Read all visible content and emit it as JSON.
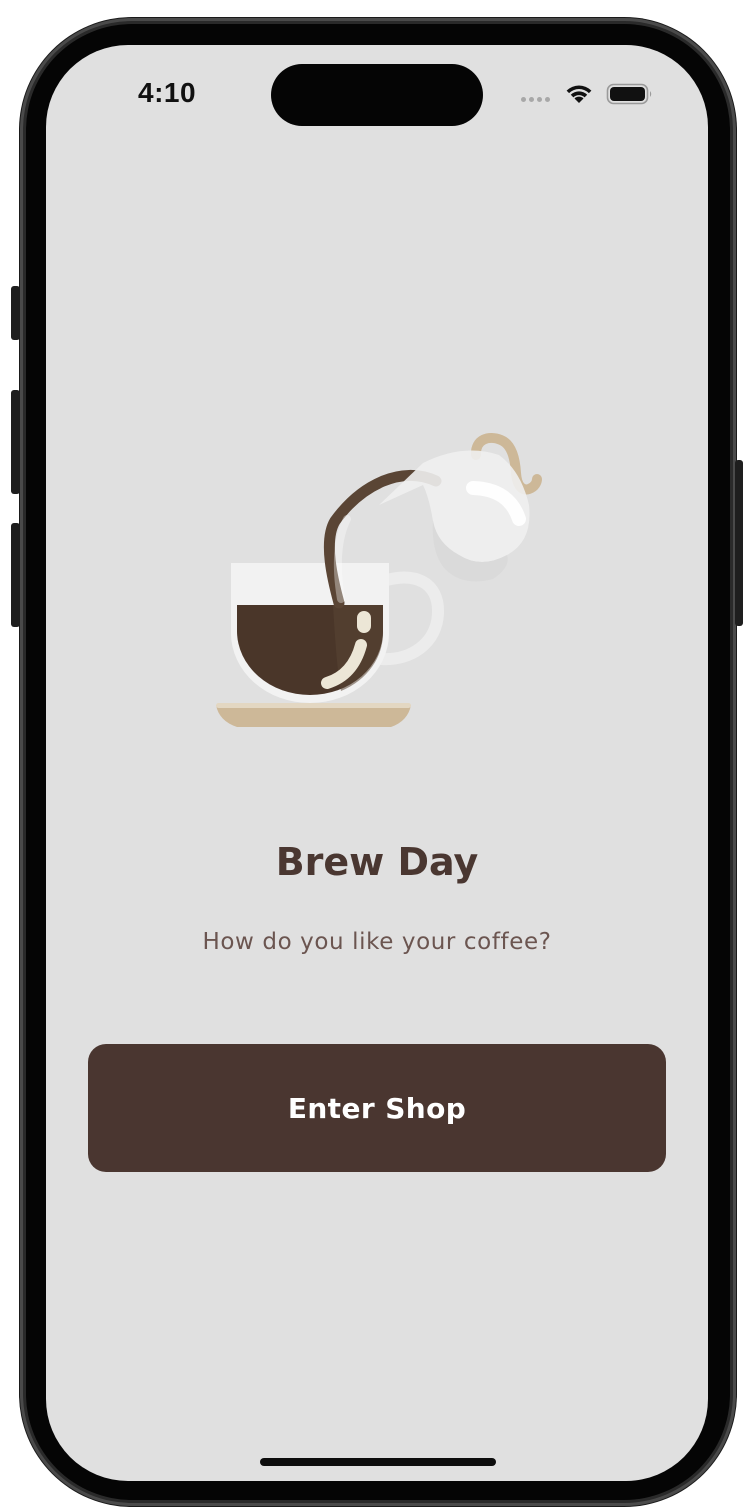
{
  "status_bar": {
    "time": "4:10",
    "wifi_icon": "wifi-icon",
    "battery_icon": "battery-full-icon",
    "signal_icon": "cellular-signal-dots-icon"
  },
  "illustration": {
    "icon": "coffee-pour-illustration",
    "colors": {
      "coffee": "#4a3629",
      "cup": "#f2f2f2",
      "saucer": "#cdb898",
      "pitcher_handle": "#cdb898"
    }
  },
  "main": {
    "title": "Brew Day",
    "subtitle": "How do you like your coffee?",
    "enter_button_label": "Enter Shop"
  },
  "theme": {
    "background": "#e0e0e0",
    "accent": "#4a3630",
    "title_color": "#4a3731",
    "subtitle_color": "#6b5550"
  }
}
